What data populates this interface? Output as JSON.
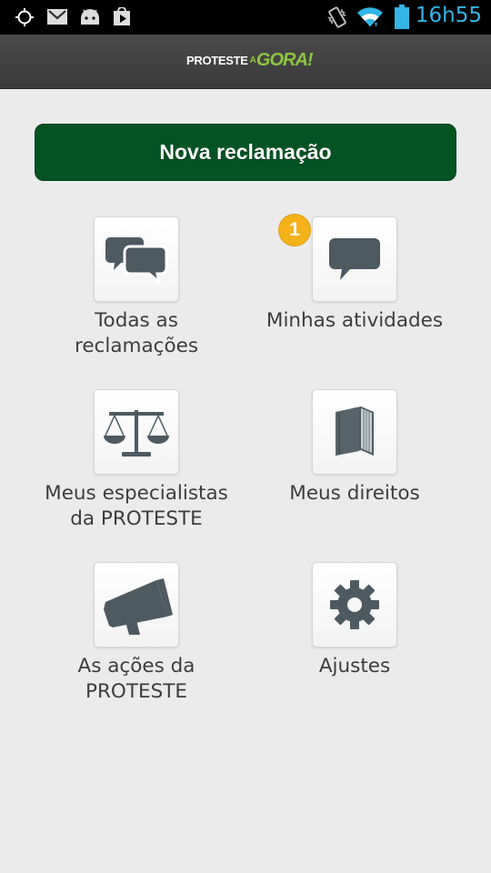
{
  "status_bar": {
    "time": "16h55",
    "icons": [
      "gps-icon",
      "gmail-icon",
      "android-icon",
      "play-store-icon",
      "vibrate-icon",
      "wifi-icon",
      "battery-icon"
    ],
    "clock_color": "#33b5e5"
  },
  "app_bar": {
    "logo_main": "PROTESTE",
    "logo_a": "A",
    "logo_b": "GORA!"
  },
  "main_button": {
    "label": "Nova reclamação",
    "color": "#035323"
  },
  "menu": [
    {
      "label_line1": "Todas as",
      "label_line2": "reclamações",
      "icon": "chat-bubbles-icon"
    },
    {
      "label_line1": "Minhas atividades",
      "label_line2": "",
      "icon": "chat-bubble-icon",
      "badge": "1"
    },
    {
      "label_line1": "Meus especialistas",
      "label_line2": "da PROTESTE",
      "icon": "scales-icon"
    },
    {
      "label_line1": "Meus direitos",
      "label_line2": "",
      "icon": "book-icon"
    },
    {
      "label_line1": "As ações da",
      "label_line2": "PROTESTE",
      "icon": "megaphone-icon"
    },
    {
      "label_line1": "Ajustes",
      "label_line2": "",
      "icon": "gear-icon"
    }
  ],
  "colors": {
    "icon": "#4d5a60",
    "badge": "#f5b21b",
    "logo_accent": "#8cc63f"
  }
}
